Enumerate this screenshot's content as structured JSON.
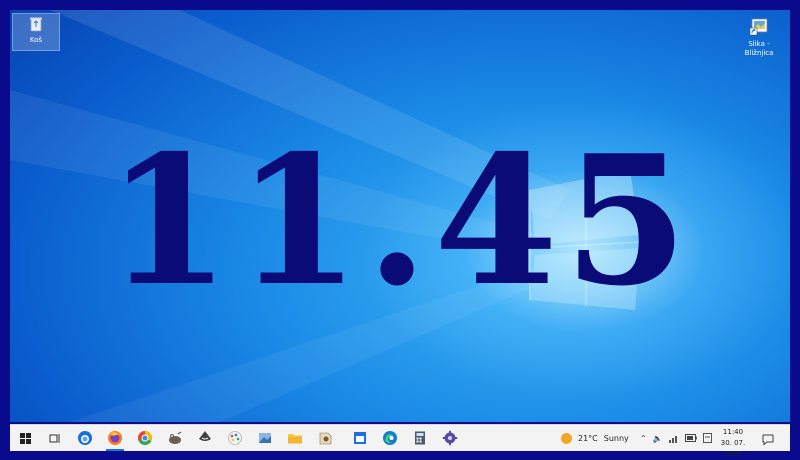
{
  "desktop": {
    "icons": [
      {
        "label": "Koš",
        "icon": "recycle-bin-icon"
      },
      {
        "label": "Slika - Bližnjica",
        "icon": "image-shortcut-icon"
      }
    ],
    "overlay_time": "11.45"
  },
  "taskbar": {
    "apps": [
      "start-button",
      "task-view",
      "mozilla-thunderbird",
      "firefox",
      "chrome",
      "gimp",
      "inkscape",
      "paint",
      "photos",
      "file-explorer",
      "notepad",
      "calendar",
      "edge",
      "calculator",
      "settings"
    ],
    "weather": {
      "temperature": "21°C",
      "condition": "Sunny"
    },
    "clock": {
      "time": "11:40",
      "date": "30. 07. 2025"
    }
  },
  "colors": {
    "frame": "#0a0a8c",
    "overlay_text": "#0b0b78",
    "taskbar": "#f3f3f3",
    "accent": "#1a73d9"
  }
}
